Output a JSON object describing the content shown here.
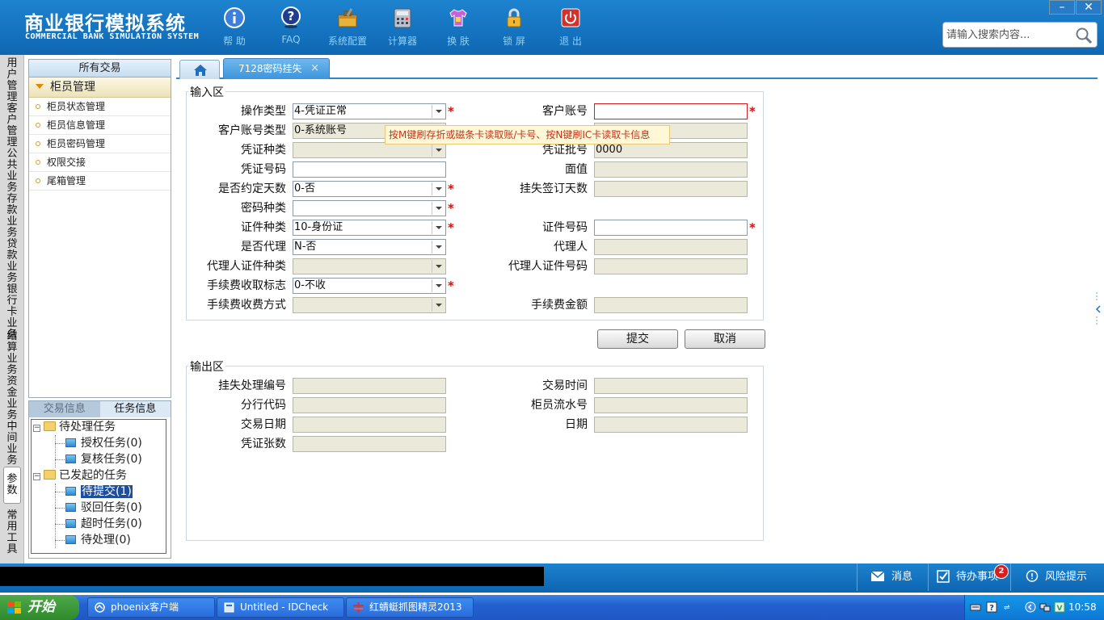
{
  "app": {
    "title": "商业银行模拟系统",
    "subtitle": "COMMERCIAL BANK SIMULATION SYSTEM"
  },
  "toolbar": [
    {
      "name": "help",
      "label": "帮 助",
      "icon": "info-icon"
    },
    {
      "name": "faq",
      "label": "FAQ",
      "icon": "question-icon"
    },
    {
      "name": "config",
      "label": "系统配置",
      "icon": "toolbox-icon"
    },
    {
      "name": "calculator",
      "label": "计算器",
      "icon": "calculator-icon"
    },
    {
      "name": "skin",
      "label": "换 肤",
      "icon": "shirt-icon"
    },
    {
      "name": "lock",
      "label": "锁 屏",
      "icon": "lock-icon"
    },
    {
      "name": "exit",
      "label": "退 出",
      "icon": "power-icon"
    }
  ],
  "search": {
    "placeholder": "请输入搜索内容..."
  },
  "window": {
    "minimize": "–",
    "close": "✕"
  },
  "vnav": [
    {
      "label": "用户管理"
    },
    {
      "label": "客户管理"
    },
    {
      "label": "公共业务"
    },
    {
      "label": "存款业务"
    },
    {
      "label": "贷款业务"
    },
    {
      "label": "银行卡业务"
    },
    {
      "label": "结算业务"
    },
    {
      "label": "资金业务"
    },
    {
      "label": "中间业务"
    },
    {
      "label": "参数"
    },
    {
      "label": "常用工具"
    }
  ],
  "sidebar": {
    "header": "所有交易",
    "group": "柜员管理",
    "items": [
      {
        "label": "柜员状态管理"
      },
      {
        "label": "柜员信息管理"
      },
      {
        "label": "柜员密码管理"
      },
      {
        "label": "权限交接"
      },
      {
        "label": "尾箱管理"
      }
    ]
  },
  "taskpanel": {
    "tabs": [
      {
        "label": "交易信息"
      },
      {
        "label": "任务信息"
      }
    ],
    "tree": {
      "pending": {
        "label": "待处理任务",
        "children": [
          {
            "label": "授权任务(0)"
          },
          {
            "label": "复核任务(0)"
          }
        ]
      },
      "initiated": {
        "label": "已发起的任务",
        "children": [
          {
            "label": "待提交(1)"
          },
          {
            "label": "驳回任务(0)"
          },
          {
            "label": "超时任务(0)"
          },
          {
            "label": "待处理(0)"
          }
        ]
      }
    }
  },
  "tabs": {
    "active": "7128密码挂失",
    "close": "×"
  },
  "input_area": {
    "legend": "输入区",
    "fields": {
      "op_type": {
        "label": "操作类型",
        "value": "4-凭证正常"
      },
      "cust_acct": {
        "label": "客户账号",
        "value": ""
      },
      "acct_type": {
        "label": "客户账号类型",
        "value": "0-系统账号"
      },
      "voucher_type": {
        "label": "凭证种类",
        "value": ""
      },
      "voucher_batch": {
        "label": "凭证批号",
        "value": "0000"
      },
      "voucher_no": {
        "label": "凭证号码",
        "value": ""
      },
      "face_value": {
        "label": "面值",
        "value": ""
      },
      "agreed_days": {
        "label": "是否约定天数",
        "value": "0-否"
      },
      "sign_days": {
        "label": "挂失签订天数",
        "value": ""
      },
      "pwd_type": {
        "label": "密码种类",
        "value": ""
      },
      "id_type": {
        "label": "证件种类",
        "value": "10-身份证"
      },
      "id_no": {
        "label": "证件号码",
        "value": ""
      },
      "is_agent": {
        "label": "是否代理",
        "value": "N-否"
      },
      "agent": {
        "label": "代理人",
        "value": ""
      },
      "agent_id_type": {
        "label": "代理人证件种类",
        "value": ""
      },
      "agent_id_no": {
        "label": "代理人证件号码",
        "value": ""
      },
      "fee_flag": {
        "label": "手续费收取标志",
        "value": "0-不收"
      },
      "fee_method": {
        "label": "手续费收费方式",
        "value": ""
      },
      "fee_amount": {
        "label": "手续费金额",
        "value": ""
      }
    },
    "tooltip": "按M键刷存折或磁条卡读取账/卡号、按N键刷IC卡读取卡信息"
  },
  "buttons": {
    "submit": "提交",
    "cancel": "取消"
  },
  "output_area": {
    "legend": "输出区",
    "fields": {
      "loss_no": {
        "label": "挂失处理编号",
        "value": ""
      },
      "trans_time": {
        "label": "交易时间",
        "value": ""
      },
      "branch_code": {
        "label": "分行代码",
        "value": ""
      },
      "teller_seq": {
        "label": "柜员流水号",
        "value": ""
      },
      "trans_date": {
        "label": "交易日期",
        "value": ""
      },
      "date": {
        "label": "日期",
        "value": ""
      },
      "voucher_count": {
        "label": "凭证张数",
        "value": ""
      }
    }
  },
  "statusbar": {
    "messages": "消息",
    "todo": "待办事项",
    "todo_count": "2",
    "risk": "风险提示"
  },
  "taskbar": {
    "start": "开始",
    "windows": [
      {
        "label": "phoenix客户端"
      },
      {
        "label": "Untitled - IDCheck"
      },
      {
        "label": "红蜻蜓抓图精灵2013"
      }
    ],
    "clock": "10:58"
  },
  "colors": {
    "header_blue": "#1d83cf",
    "required_red": "#c81414",
    "tooltip_bg": "#fff8d6",
    "disabled_bg": "#ebe9da"
  }
}
